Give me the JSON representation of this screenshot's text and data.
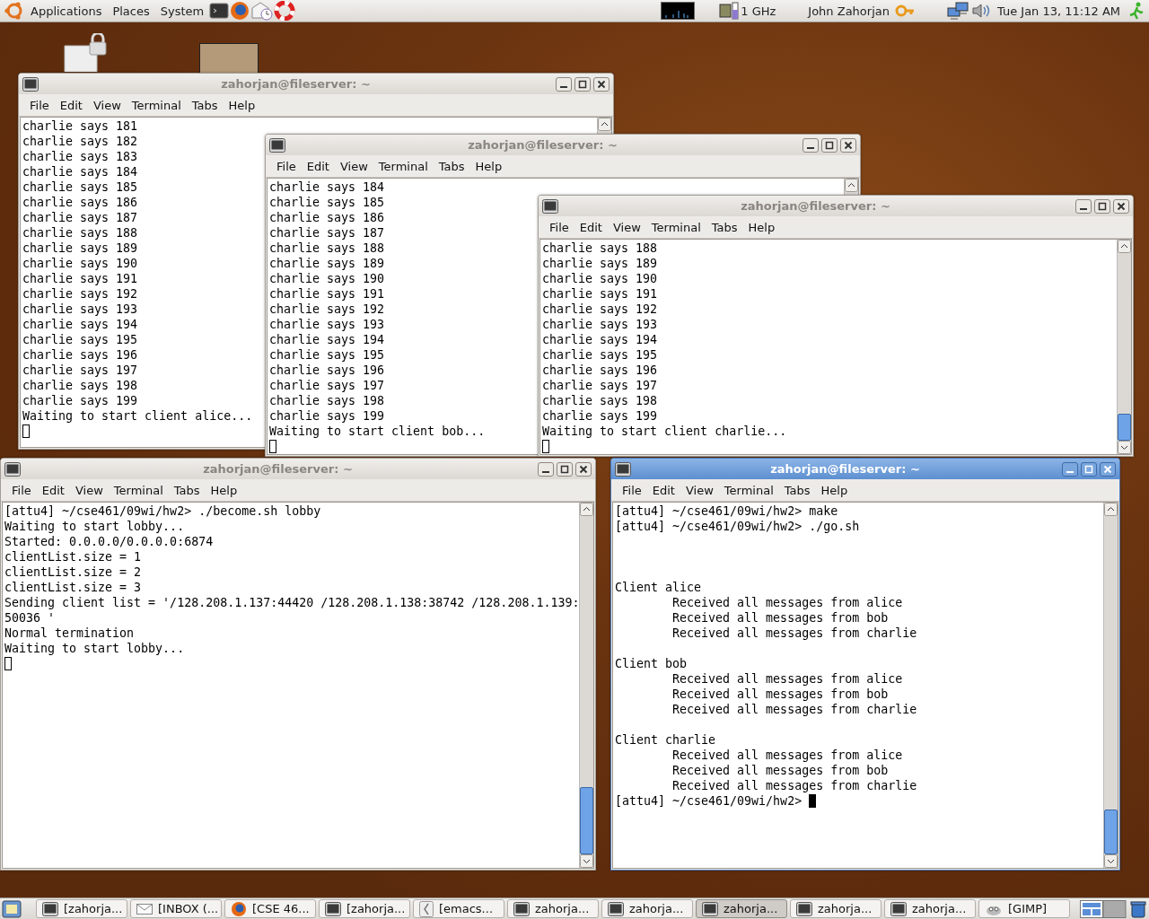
{
  "top_panel": {
    "menus": [
      "Applications",
      "Places",
      "System"
    ],
    "cpu_frequency": "1 GHz",
    "user": "John Zahorjan",
    "clock": "Tue Jan 13, 11:12 AM"
  },
  "windows": [
    {
      "title": "zahorjan@fileserver: ~",
      "focused": false,
      "menu": [
        "File",
        "Edit",
        "View",
        "Terminal",
        "Tabs",
        "Help"
      ],
      "lines": [
        "charlie says 181",
        "charlie says 182",
        "charlie says 183",
        "charlie says 184",
        "charlie says 185",
        "charlie says 186",
        "charlie says 187",
        "charlie says 188",
        "charlie says 189",
        "charlie says 190",
        "charlie says 191",
        "charlie says 192",
        "charlie says 193",
        "charlie says 194",
        "charlie says 195",
        "charlie says 196",
        "charlie says 197",
        "charlie says 198",
        "charlie says 199",
        "Waiting to start client alice...",
        {
          "kind": "blank"
        }
      ]
    },
    {
      "title": "zahorjan@fileserver: ~",
      "focused": false,
      "menu": [
        "File",
        "Edit",
        "View",
        "Terminal",
        "Tabs",
        "Help"
      ],
      "lines": [
        "charlie says 184",
        "charlie says 185",
        "charlie says 186",
        "charlie says 187",
        "charlie says 188",
        "charlie says 189",
        "charlie says 190",
        "charlie says 191",
        "charlie says 192",
        "charlie says 193",
        "charlie says 194",
        "charlie says 195",
        "charlie says 196",
        "charlie says 197",
        "charlie says 198",
        "charlie says 199",
        "Waiting to start client bob...",
        {
          "kind": "blank"
        }
      ]
    },
    {
      "title": "zahorjan@fileserver: ~",
      "focused": false,
      "menu": [
        "File",
        "Edit",
        "View",
        "Terminal",
        "Tabs",
        "Help"
      ],
      "lines": [
        "charlie says 188",
        "charlie says 189",
        "charlie says 190",
        "charlie says 191",
        "charlie says 192",
        "charlie says 193",
        "charlie says 194",
        "charlie says 195",
        "charlie says 196",
        "charlie says 197",
        "charlie says 198",
        "charlie says 199",
        "Waiting to start client charlie...",
        {
          "kind": "blank"
        }
      ]
    },
    {
      "title": "zahorjan@fileserver: ~",
      "focused": false,
      "menu": [
        "File",
        "Edit",
        "View",
        "Terminal",
        "Tabs",
        "Help"
      ],
      "lines": [
        "[attu4] ~/cse461/09wi/hw2> ./become.sh lobby",
        "Waiting to start lobby...",
        "Started: 0.0.0.0/0.0.0.0:6874",
        "clientList.size = 1",
        "clientList.size = 2",
        "clientList.size = 3",
        "Sending client list = '/128.208.1.137:44420 /128.208.1.138:38742 /128.208.1.139:",
        "50036 '",
        "Normal termination",
        "Waiting to start lobby...",
        {
          "kind": "blank"
        }
      ]
    },
    {
      "title": "zahorjan@fileserver: ~",
      "focused": true,
      "menu": [
        "File",
        "Edit",
        "View",
        "Terminal",
        "Tabs",
        "Help"
      ],
      "lines": [
        "[attu4] ~/cse461/09wi/hw2> make",
        "[attu4] ~/cse461/09wi/hw2> ./go.sh",
        {
          "kind": "blank"
        },
        {
          "kind": "blank"
        },
        {
          "kind": "blank"
        },
        "Client alice",
        "        Received all messages from alice",
        "        Received all messages from bob",
        "        Received all messages from charlie",
        {
          "kind": "blank"
        },
        "Client bob",
        "        Received all messages from alice",
        "        Received all messages from bob",
        "        Received all messages from charlie",
        {
          "kind": "blank"
        },
        "Client charlie",
        "        Received all messages from alice",
        "        Received all messages from bob",
        "        Received all messages from charlie",
        "[attu4] ~/cse461/09wi/hw2> "
      ]
    }
  ],
  "taskbar": {
    "tasks": [
      {
        "label": "[zahorja...",
        "kind": "terminal",
        "selected": false
      },
      {
        "label": "[INBOX (...",
        "kind": "mail",
        "selected": false
      },
      {
        "label": "[CSE 46...",
        "kind": "browser",
        "selected": false
      },
      {
        "label": "[zahorja...",
        "kind": "terminal",
        "selected": false
      },
      {
        "label": "[emacs...",
        "kind": "editor",
        "selected": false
      },
      {
        "label": "zahorja...",
        "kind": "terminal",
        "selected": false
      },
      {
        "label": "zahorja...",
        "kind": "terminal",
        "selected": false
      },
      {
        "label": "zahorja...",
        "kind": "terminal",
        "selected": true
      },
      {
        "label": "zahorja...",
        "kind": "terminal",
        "selected": false
      },
      {
        "label": "zahorja...",
        "kind": "terminal",
        "selected": false
      },
      {
        "label": "[GIMP]",
        "kind": "gimp",
        "selected": false
      }
    ]
  }
}
